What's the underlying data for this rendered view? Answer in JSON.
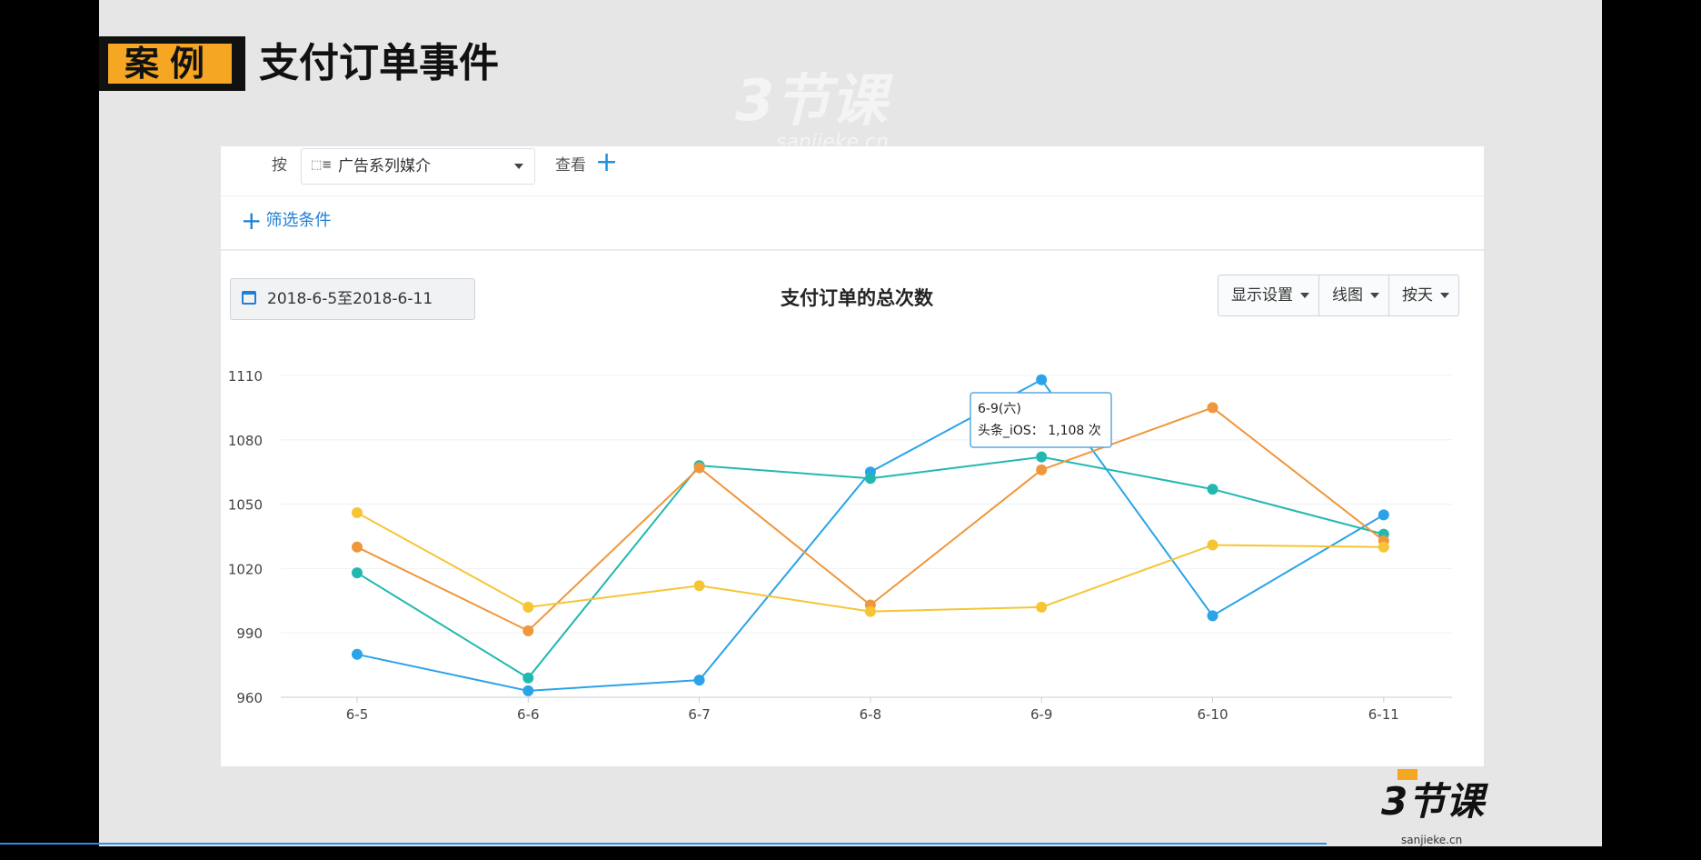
{
  "slide": {
    "badge": "案例",
    "title": "支付订单事件",
    "watermark_main": "3节课",
    "watermark_sub": "sanjieke.cn"
  },
  "toolbar": {
    "by_label": "按",
    "dimension_icon": "tag-icon",
    "dimension_value": "广告系列媒介",
    "view_label": "查看",
    "add_filter_label": "筛选条件"
  },
  "date_range": "2018-6-5至2018-6-11",
  "controls": {
    "display_settings": "显示设置",
    "chart_type": "线图",
    "granularity": "按天"
  },
  "tooltip": {
    "date": "6-9(六)",
    "label": "头条_iOS：",
    "value": "1,108 次"
  },
  "logo": {
    "text": "3节课",
    "url": "sanjieke.cn"
  },
  "chart_data": {
    "type": "line",
    "title": "支付订单的总次数",
    "categories": [
      "6-5",
      "6-6",
      "6-7",
      "6-8",
      "6-9",
      "6-10",
      "6-11"
    ],
    "ylim": [
      960,
      1110
    ],
    "yticks": [
      960,
      990,
      1020,
      1050,
      1080,
      1110
    ],
    "grid": true,
    "series": [
      {
        "color": "#2aa3e8",
        "values": [
          980,
          963,
          968,
          1065,
          1108,
          998,
          1045
        ]
      },
      {
        "color": "#22b8b0",
        "values": [
          1018,
          969,
          1068,
          1062,
          1072,
          1057,
          1036
        ]
      },
      {
        "color": "#f0963c",
        "values": [
          1030,
          991,
          1067,
          1003,
          1066,
          1095,
          1033
        ]
      },
      {
        "color": "#f6c533",
        "values": [
          1046,
          1002,
          1012,
          1000,
          1002,
          1031,
          1030
        ]
      }
    ]
  }
}
